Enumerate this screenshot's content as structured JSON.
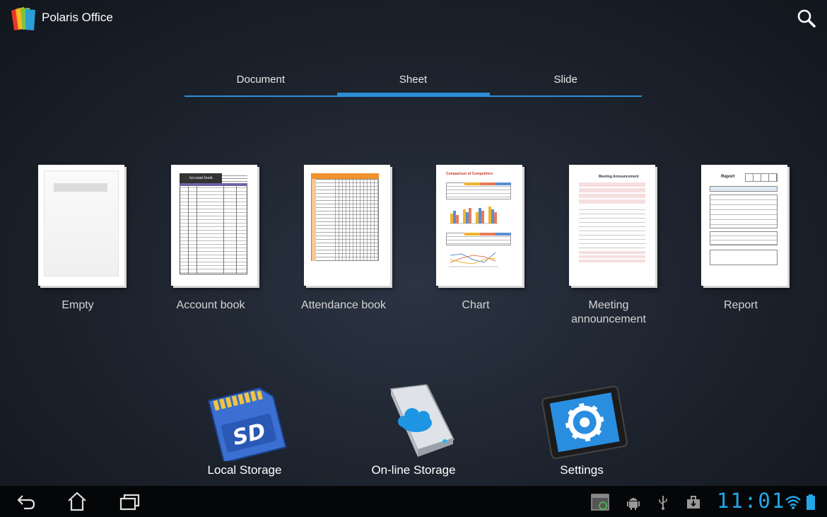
{
  "app": {
    "title": "Polaris Office"
  },
  "tabs": [
    {
      "label": "Document"
    },
    {
      "label": "Sheet"
    },
    {
      "label": "Slide"
    }
  ],
  "selected_tab": "Sheet",
  "templates": [
    {
      "label": "Empty"
    },
    {
      "label": "Account book"
    },
    {
      "label": "Attendance book"
    },
    {
      "label": "Chart"
    },
    {
      "label": "Meeting announcement"
    },
    {
      "label": "Report"
    }
  ],
  "thumbnails": {
    "account_title": "Account book",
    "chart_title": "Comparison of Competitors",
    "meeting_title": "Meeting Announcement",
    "report_title": "Report"
  },
  "storage": [
    {
      "label": "Local Storage",
      "icon": "sd-card-icon"
    },
    {
      "label": "On-line Storage",
      "icon": "cloud-drive-icon"
    },
    {
      "label": "Settings",
      "icon": "gear-tablet-icon"
    }
  ],
  "system": {
    "clock": "11:01"
  },
  "colors": {
    "accent": "#2b8fd6",
    "clock": "#22a7e8"
  }
}
